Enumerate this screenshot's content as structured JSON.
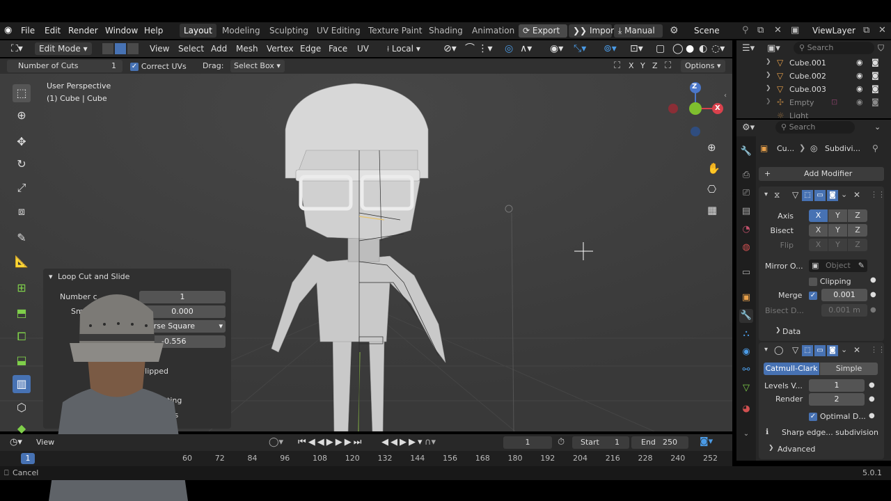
{
  "topbar": {
    "menus": [
      "File",
      "Edit",
      "Render",
      "Window",
      "Help"
    ],
    "workspaces": [
      "Layout",
      "Modeling",
      "Sculpting",
      "UV Editing",
      "Texture Paint",
      "Shading",
      "Animation"
    ],
    "export_label": "Export",
    "import_label": "Import",
    "manual_label": "Manual",
    "scene_label": "Scene",
    "viewlayer_label": "ViewLayer"
  },
  "header": {
    "mode": "Edit Mode",
    "menus": [
      "View",
      "Select",
      "Add",
      "Mesh",
      "Vertex",
      "Edge",
      "Face",
      "UV"
    ],
    "orientation": "Local"
  },
  "operator_bar": {
    "number_of_cuts_label": "Number of Cuts",
    "number_of_cuts_value": "1",
    "correct_uvs_label": "Correct UVs",
    "drag_label": "Drag:",
    "drag_value": "Select Box",
    "axes": [
      "X",
      "Y",
      "Z"
    ],
    "options_label": "Options"
  },
  "viewport": {
    "perspective": "User Perspective",
    "object_info": "(1) Cube | Cube",
    "gizmo_axes": {
      "z": "Z",
      "y": "Y",
      "x": "X"
    }
  },
  "loop_panel": {
    "title": "Loop Cut and Slide",
    "number_label": "Number c",
    "number_value": "1",
    "smooth_label": "Sm",
    "smooth_value": "0.000",
    "falloff_value": "erse Square",
    "factor_value": "-0.556",
    "flipped_label": "Flipped",
    "clamp_label": "ting",
    "uvs_label": "Vs"
  },
  "timeline": {
    "view_label": "View",
    "current_frame": "1",
    "start_label": "Start",
    "start_value": "1",
    "end_label": "End",
    "end_value": "250"
  },
  "ruler": {
    "current": "1",
    "ticks": [
      "60",
      "72",
      "84",
      "96",
      "108",
      "120",
      "132",
      "144",
      "156",
      "168",
      "180",
      "192",
      "204",
      "216",
      "228",
      "240",
      "252"
    ]
  },
  "status": {
    "cancel_label": "Cancel",
    "version": "5.0.1"
  },
  "outliner": {
    "search_placeholder": "Search",
    "items": [
      "Cube.001",
      "Cube.002",
      "Cube.003",
      "Empty",
      "Light"
    ]
  },
  "properties": {
    "search_placeholder": "Search",
    "breadcrumb_object": "Cu...",
    "breadcrumb_modifier": "Subdivi...",
    "add_modifier_label": "Add Modifier",
    "mirror": {
      "axis_label": "Axis",
      "bisect_label": "Bisect",
      "flip_label": "Flip",
      "axes": [
        "X",
        "Y",
        "Z"
      ],
      "mirror_object_label": "Mirror O...",
      "object_placeholder": "Object",
      "clipping_label": "Clipping",
      "merge_label": "Merge",
      "merge_value": "0.001",
      "bisect_distance_label": "Bisect D...",
      "bisect_distance_value": "0.001 m",
      "data_label": "Data"
    },
    "subdivision": {
      "catmull_label": "Catmull-Clark",
      "simple_label": "Simple",
      "levels_label": "Levels V...",
      "levels_value": "1",
      "render_label": "Render",
      "render_value": "2",
      "optimal_label": "Optimal D...",
      "sharp_label": "Sharp edge... subdivision",
      "advanced_label": "Advanced"
    }
  }
}
